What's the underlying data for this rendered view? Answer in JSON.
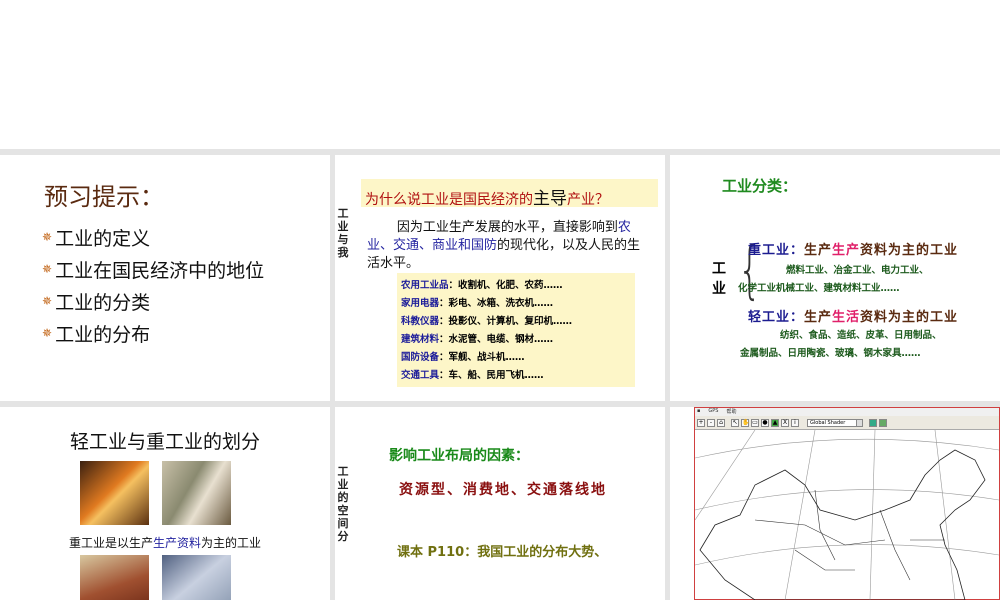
{
  "slides": [
    {
      "title": "预习提示：",
      "items": [
        "工业的定义",
        "工业在国民经济中的地位",
        "工业的分类",
        "工业的分布"
      ]
    },
    {
      "side_label": "工业与我",
      "question_pre": "为什么说工业是国民经济的",
      "question_key": "主导",
      "question_post": "产业？",
      "para_a": "因为工业生产发展的水平，直接影响到",
      "para_blue": "农业、交通、商业和国防",
      "para_b": "的现代化，以及人民的生活水平。",
      "rows": [
        {
          "k": "农用工业品",
          "v": "：收割机、化肥、农药……"
        },
        {
          "k": "家用电器",
          "v": "：彩电、冰箱、洗衣机……"
        },
        {
          "k": "科教仪器",
          "v": "：投影仪、计算机、复印机……"
        },
        {
          "k": "建筑材料",
          "v": "：水泥管、电缆、钢材……"
        },
        {
          "k": "国防设备",
          "v": "：军舰、战斗机……"
        },
        {
          "k": "交通工具",
          "v": "：车、船、民用飞机……"
        }
      ]
    },
    {
      "title": "工业分类：",
      "root": "工业",
      "heavy": {
        "label": "重工业：",
        "a": "生产",
        "b": "生产",
        "c": "资料为主的工业",
        "ex1": "燃料工业、冶金工业、电力工业、",
        "ex2": "化学工业机械工业、建筑材料工业……"
      },
      "light": {
        "label": "轻工业：",
        "a": "生产",
        "b": "生活",
        "c": "资料为主的工业",
        "ex1": "纺织、食品、造纸、皮革、日用制品、",
        "ex2": "金属制品、日用陶瓷、玻璃、钢木家具……"
      }
    },
    {
      "title": "轻工业与重工业的划分",
      "cap_a": "重工业是以生产",
      "cap_blue": "生产资料",
      "cap_b": "为主的工业"
    },
    {
      "side_label": "工业的空间分",
      "l1": "影响工业布局的因素：",
      "l2": "资源型、消费地、交通落线地",
      "l3": "课本 P110：我国工业的分布大势、"
    },
    {
      "menu": [
        "GPS",
        "帮助"
      ],
      "layer_select": "Global Shader"
    }
  ]
}
